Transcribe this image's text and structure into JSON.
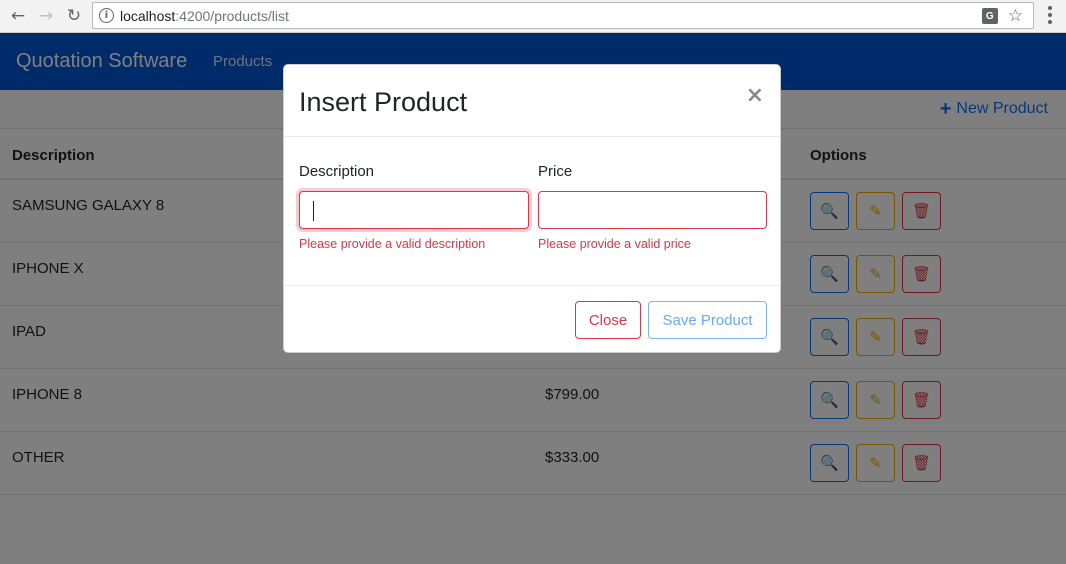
{
  "browser": {
    "back_icon": "arrow-left",
    "forward_icon": "arrow-right",
    "reload_icon": "reload",
    "url_host": "localhost",
    "url_rest": ":4200/products/list"
  },
  "navbar": {
    "brand": "Quotation Software",
    "link": "Products",
    "color": "#0056d6"
  },
  "page": {
    "new_product": "New Product",
    "columns": {
      "description": "Description",
      "options": "Options"
    },
    "rows": [
      {
        "description": "SAMSUNG GALAXY 8",
        "price": ""
      },
      {
        "description": "IPHONE X",
        "price": ""
      },
      {
        "description": "IPAD",
        "price": ""
      },
      {
        "description": "IPHONE 8",
        "price": "$799.00"
      },
      {
        "description": "OTHER",
        "price": "$333.00"
      }
    ]
  },
  "modal": {
    "title": "Insert Product",
    "close_symbol": "×",
    "description_label": "Description",
    "description_value": "",
    "description_error": "Please provide a valid description",
    "price_label": "Price",
    "price_value": "",
    "price_error": "Please provide a valid price",
    "close_button": "Close",
    "save_button": "Save Product"
  },
  "colors": {
    "primary": "#0d6efd",
    "warning": "#f0ad00",
    "danger": "#dc3545"
  }
}
